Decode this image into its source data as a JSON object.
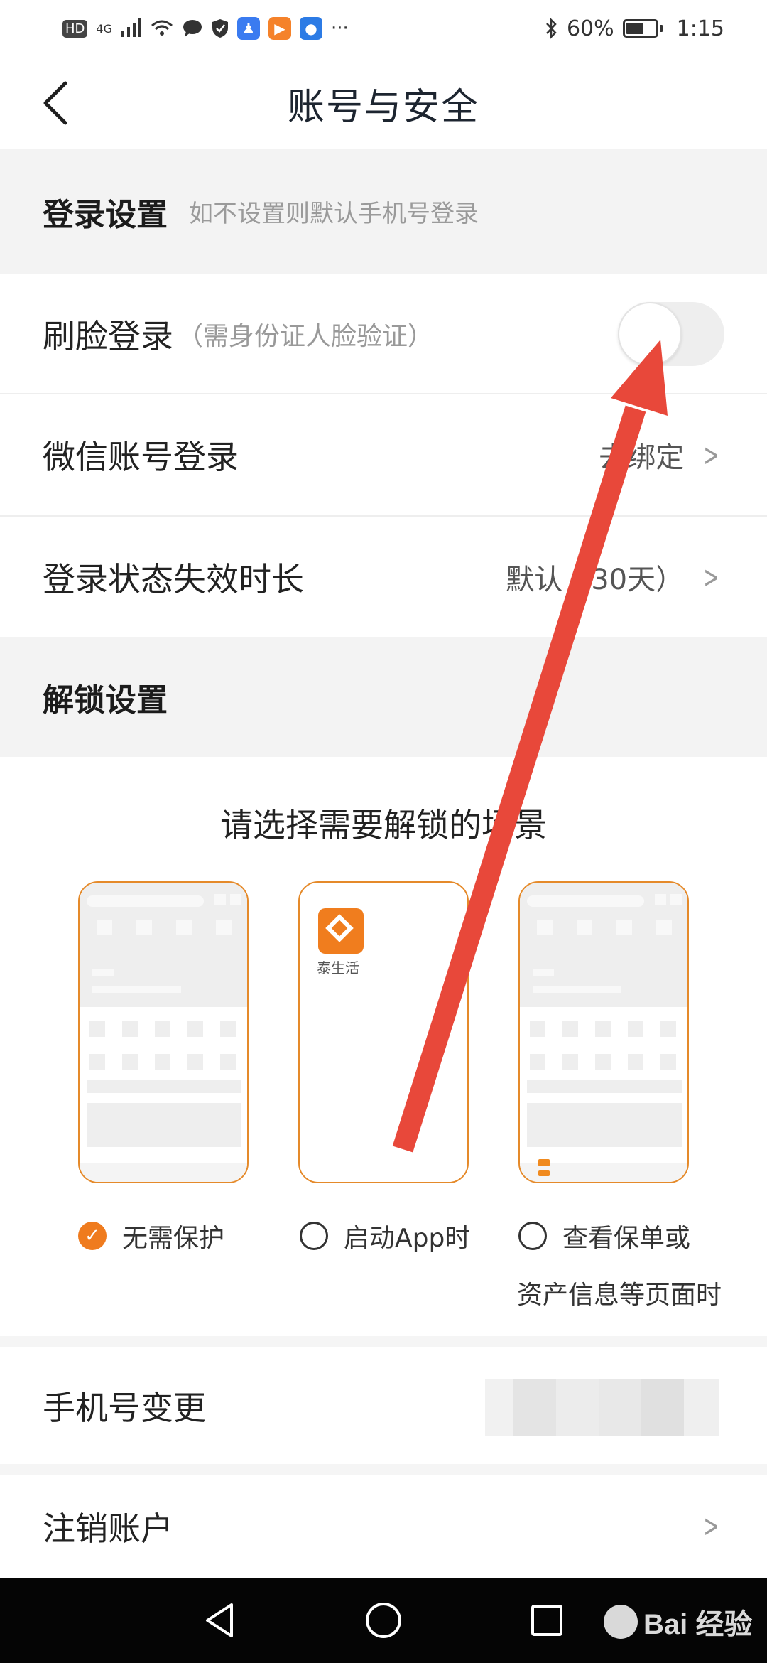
{
  "status_bar": {
    "hd": "HD",
    "network": "4G",
    "battery_text": "60%",
    "battery_level": 0.6,
    "time": "1:15",
    "more": "···"
  },
  "nav": {
    "title": "账号与安全"
  },
  "login_settings": {
    "title": "登录设置",
    "subtitle": "如不设置则默认手机号登录",
    "face_login": {
      "label": "刷脸登录",
      "hint": "（需身份证人脸验证）",
      "enabled": false
    },
    "wechat_login": {
      "label": "微信账号登录",
      "value": "去绑定"
    },
    "session_timeout": {
      "label": "登录状态失效时长",
      "value": "默认（30天）"
    }
  },
  "unlock_settings": {
    "title": "解锁设置",
    "prompt": "请选择需要解锁的场景",
    "app_name": "泰生活",
    "options": [
      {
        "label": "无需保护",
        "selected": true
      },
      {
        "label": "启动App时",
        "selected": false
      },
      {
        "label": "查看保单或",
        "label_line2": "资产信息等页面时",
        "selected": false
      }
    ]
  },
  "phone_change": {
    "label": "手机号变更"
  },
  "cancel_account": {
    "label": "注销账户"
  },
  "watermark": {
    "text": "Bai 经验"
  },
  "colors": {
    "accent": "#ef7b1e",
    "arrow": "#e8483a"
  }
}
